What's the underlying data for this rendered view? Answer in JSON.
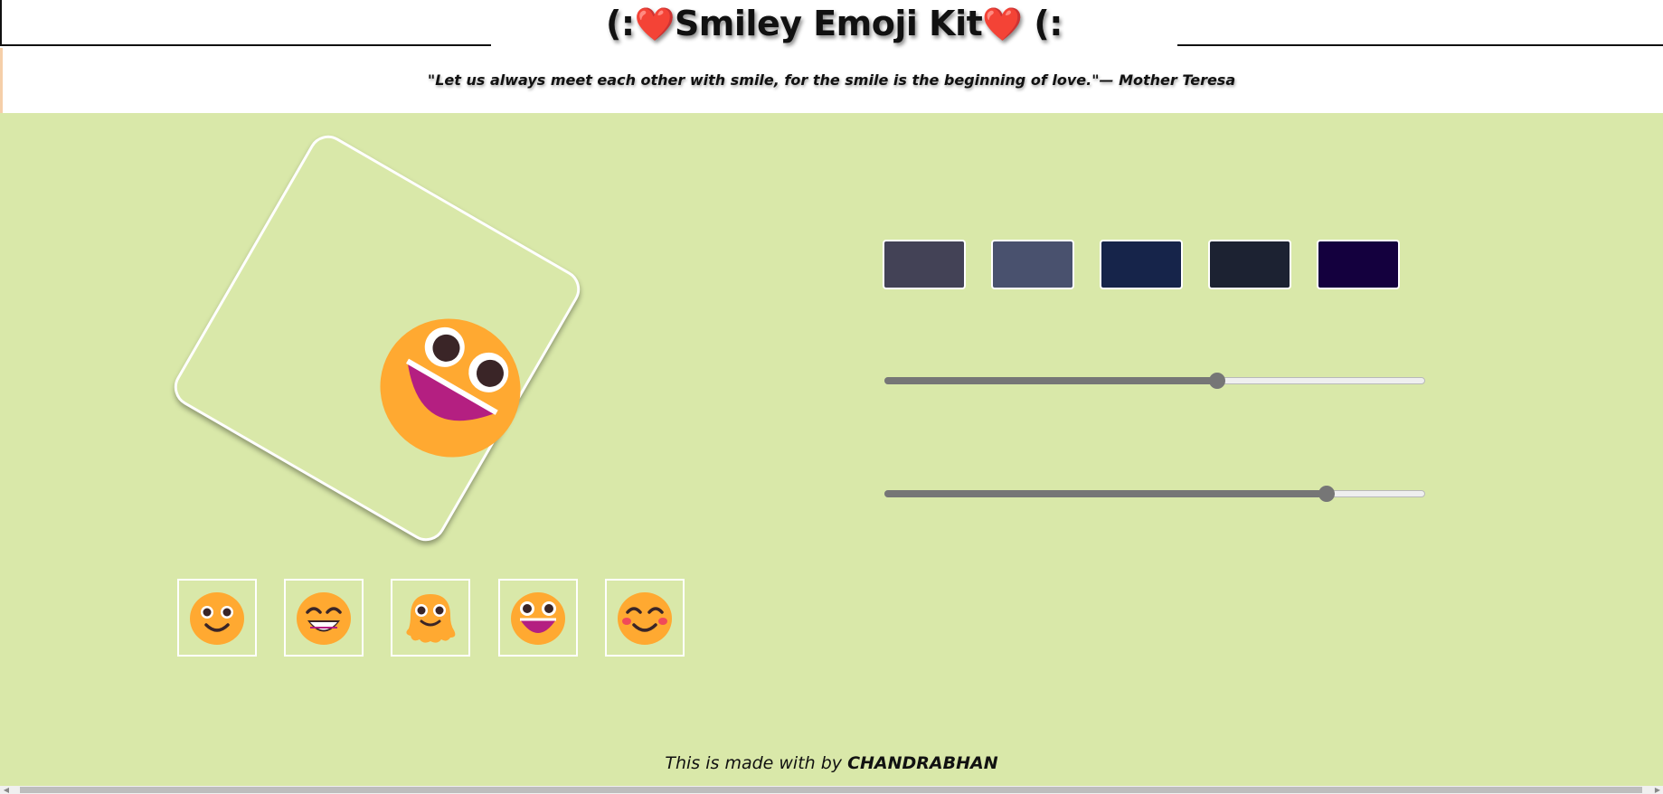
{
  "header": {
    "title_prefix": "(:",
    "title_heart_left": "❤️",
    "title_text": "Smiley Emoji Kit",
    "title_heart_right": "❤️",
    "title_suffix": "(:",
    "quote": "\"Let us always meet each other with smile, for the smile is the beginning of love.\"— Mother Teresa"
  },
  "main": {
    "background": "#d9e8a9",
    "preview": {
      "emoji": "grinning-squinting-tilted-emoji",
      "rotation_deg": 30
    },
    "thumbnails": [
      {
        "name": "slightly-smiling-face"
      },
      {
        "name": "grinning-face-with-smiling-eyes"
      },
      {
        "name": "melting-face"
      },
      {
        "name": "grinning-face-with-big-eyes"
      },
      {
        "name": "smiling-face-with-smiling-eyes"
      }
    ],
    "swatches": [
      {
        "color": "#434256"
      },
      {
        "color": "#49516e"
      },
      {
        "color": "#16244a"
      },
      {
        "color": "#1c2232"
      },
      {
        "color": "#14003e"
      }
    ],
    "sliders": [
      {
        "name": "size-slider",
        "value_fraction": 0.615
      },
      {
        "name": "rotation-slider",
        "value_fraction": 0.818
      }
    ]
  },
  "footer": {
    "prefix": "This is made with by ",
    "author": "CHANDRABHAN"
  }
}
